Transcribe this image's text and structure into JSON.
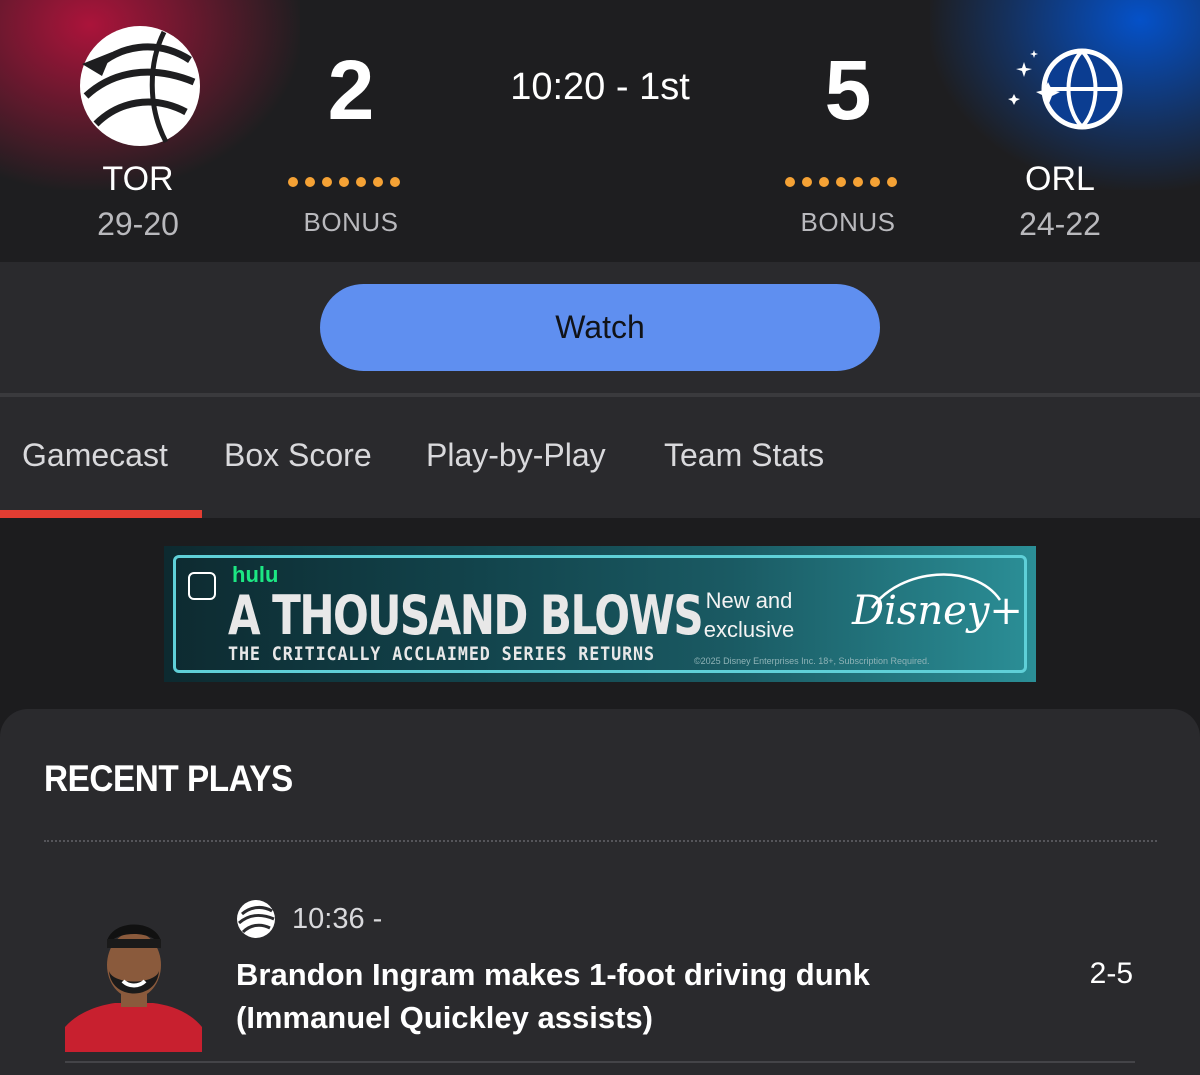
{
  "scoreboard": {
    "home": {
      "abbr": "TOR",
      "record": "29-20",
      "score": "2",
      "bonus_label": "BONUS",
      "fouls_remaining": 7,
      "logo_icon": "raptors-claw-basketball-icon",
      "color": "#ce1141"
    },
    "away": {
      "abbr": "ORL",
      "record": "24-22",
      "score": "5",
      "bonus_label": "BONUS",
      "fouls_remaining": 7,
      "logo_icon": "magic-star-basketball-icon",
      "color": "#0077c0"
    },
    "clock": "10:20 - 1st",
    "foul_dot_color": "#f5a235"
  },
  "watch": {
    "label": "Watch",
    "color": "#5f8ff0"
  },
  "tabs": [
    {
      "label": "Gamecast",
      "active": true
    },
    {
      "label": "Box Score",
      "active": false
    },
    {
      "label": "Play-by-Play",
      "active": false
    },
    {
      "label": "Team Stats",
      "active": false
    }
  ],
  "tab_accent_color": "#e23d32",
  "ad": {
    "network": "hulu",
    "title": "A THOUSAND BLOWS",
    "subtitle": "THE CRITICALLY ACCLAIMED SERIES RETURNS",
    "tagline": "New and exclusive",
    "brand": "Disney+",
    "legal": "©2025 Disney Enterprises Inc. 18+, Subscription Required."
  },
  "recent_plays": {
    "title": "RECENT PLAYS",
    "plays": [
      {
        "team_logo_icon": "raptors-claw-basketball-icon",
        "time": "10:36 -",
        "text": "Brandon Ingram makes 1-foot driving dunk (Immanuel Quickley assists)",
        "score": "2-5",
        "headshot_icon": "player-headshot"
      }
    ]
  }
}
